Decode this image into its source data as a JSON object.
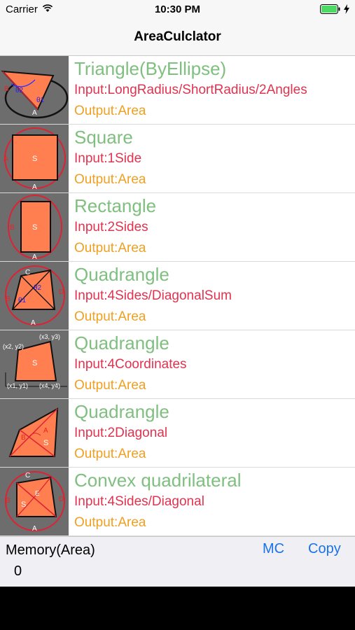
{
  "status": {
    "carrier": "Carrier",
    "time": "10:30 PM"
  },
  "nav": {
    "title": "AreaCulclator"
  },
  "rows": [
    {
      "name": "Triangle(ByEllipse)",
      "input": "Input:LongRadius/ShortRadius/2Angles",
      "output": "Output:Area",
      "icon": "triangle-ellipse-icon"
    },
    {
      "name": "Square",
      "input": "Input:1Side",
      "output": "Output:Area",
      "icon": "square-icon"
    },
    {
      "name": "Rectangle",
      "input": "Input:2Sides",
      "output": "Output:Area",
      "icon": "rectangle-icon"
    },
    {
      "name": "Quadrangle",
      "input": "Input:4Sides/DiagonalSum",
      "output": "Output:Area",
      "icon": "quadrangle-sides-icon"
    },
    {
      "name": "Quadrangle",
      "input": "Input:4Coordinates",
      "output": "Output:Area",
      "icon": "quadrangle-coordinates-icon"
    },
    {
      "name": "Quadrangle",
      "input": "Input:2Diagonal",
      "output": "Output:Area",
      "icon": "quadrangle-diagonal-icon"
    },
    {
      "name": "Convex quadrilateral",
      "input": "Input:4Sides/Diagonal",
      "output": "Output:Area",
      "icon": "convex-quadrilateral-icon"
    }
  ],
  "thumb_labels": {
    "triangle": {
      "b": "B",
      "theta2": "θ2",
      "theta1": "θ1",
      "a": "A"
    },
    "square": {
      "a": "A",
      "s": "S",
      "a2": "A"
    },
    "rectangle": {
      "b": "B",
      "s": "S",
      "a": "A"
    },
    "quad4": {
      "c": "C",
      "theta2": "θ2",
      "d": "D",
      "b": "B",
      "theta1": "θ1",
      "a": "A"
    },
    "coords": {
      "p3": "(x3, y3)",
      "p2": "(x2, y2)",
      "s": "S",
      "p1": "(x1, y1)",
      "p4": "(x4, y4)"
    },
    "diag": {
      "a": "A",
      "b": "B",
      "s": "S"
    },
    "convex": {
      "c": "C",
      "e": "E",
      "b": "B",
      "s": "S",
      "d": "D",
      "a": "A"
    }
  },
  "memory": {
    "label": "Memory(Area)",
    "value": "0",
    "mc_label": "MC",
    "copy_label": "Copy"
  },
  "colors": {
    "name": "#7fbf7f",
    "input": "#e0334f",
    "output": "#f0a020",
    "link": "#1a73e8",
    "shape": "#ff7f50"
  }
}
